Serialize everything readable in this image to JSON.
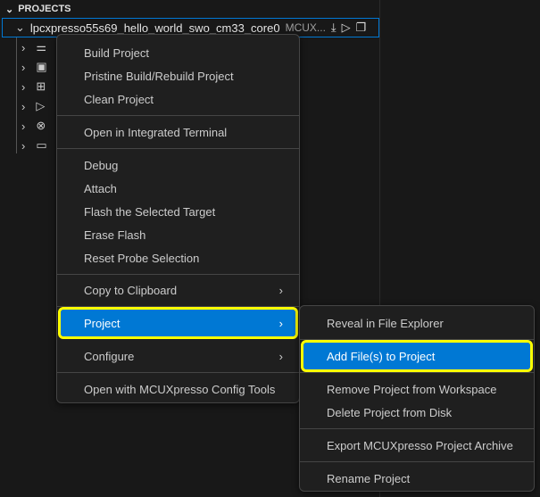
{
  "header": {
    "title": "PROJECTS"
  },
  "project": {
    "name": "lpcxpresso55s69_hello_world_swo_cm33_core0",
    "description": "MCUX...",
    "actions": [
      "download-icon",
      "run-icon",
      "copy-icon"
    ]
  },
  "tree_icons": [
    "settings-sliders-icon",
    "schematic-icon",
    "extensions-icon",
    "debug-icon",
    "link-icon",
    "folder-icon"
  ],
  "menu": {
    "items": [
      "Build Project",
      "Pristine Build/Rebuild Project",
      "Clean Project",
      "Open in Integrated Terminal",
      "Debug",
      "Attach",
      "Flash the Selected Target",
      "Erase Flash",
      "Reset Probe Selection",
      "Copy to Clipboard",
      "Project",
      "Configure",
      "Open with MCUXpresso Config Tools"
    ]
  },
  "submenu": {
    "items": [
      "Reveal in File Explorer",
      "Add File(s) to Project",
      "Remove Project from Workspace",
      "Delete Project from Disk",
      "Export MCUXpresso Project Archive",
      "Rename Project"
    ]
  },
  "colors": {
    "highlight": "#0078d4",
    "callout": "#ffff00"
  }
}
